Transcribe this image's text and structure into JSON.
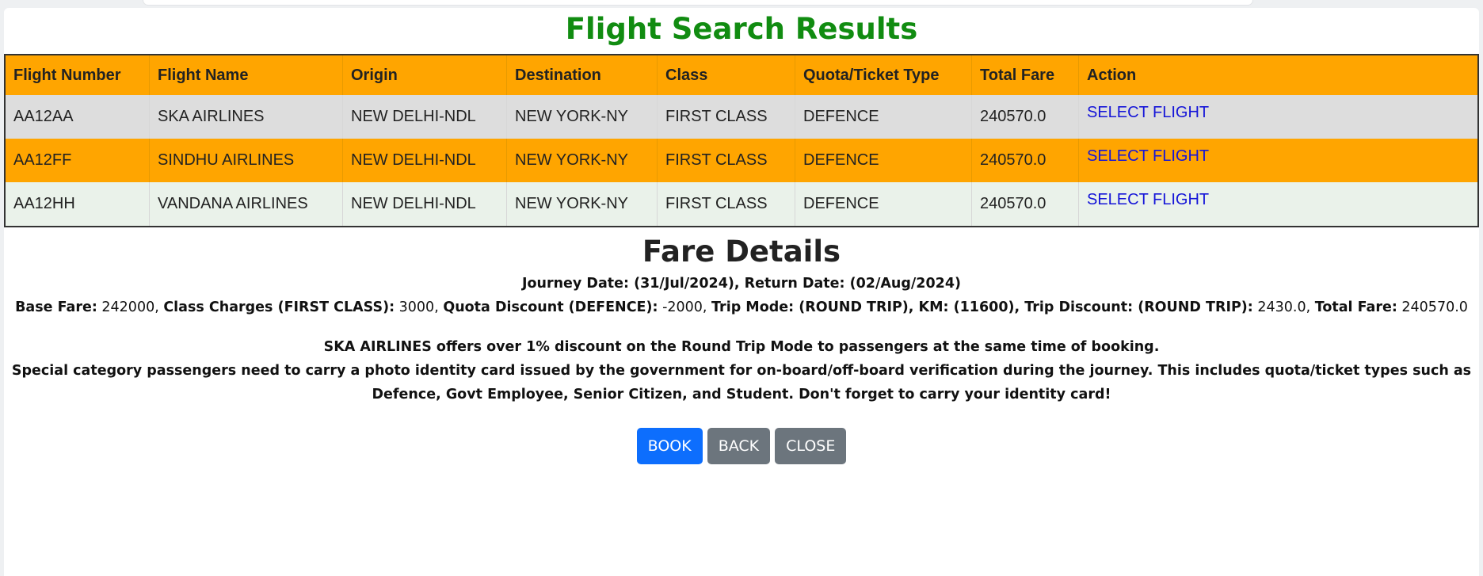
{
  "results": {
    "title": "Flight Search Results",
    "columns": [
      "Flight Number",
      "Flight Name",
      "Origin",
      "Destination",
      "Class",
      "Quota/Ticket Type",
      "Total Fare",
      "Action"
    ],
    "rows": [
      {
        "flight_number": "AA12AA",
        "flight_name": "SKA AIRLINES",
        "origin": "NEW DELHI-NDL",
        "destination": "NEW YORK-NY",
        "class": "FIRST CLASS",
        "quota": "DEFENCE",
        "total_fare": "240570.0",
        "action": "SELECT FLIGHT"
      },
      {
        "flight_number": "AA12FF",
        "flight_name": "SINDHU AIRLINES",
        "origin": "NEW DELHI-NDL",
        "destination": "NEW YORK-NY",
        "class": "FIRST CLASS",
        "quota": "DEFENCE",
        "total_fare": "240570.0",
        "action": "SELECT FLIGHT"
      },
      {
        "flight_number": "AA12HH",
        "flight_name": "VANDANA AIRLINES",
        "origin": "NEW DELHI-NDL",
        "destination": "NEW YORK-NY",
        "class": "FIRST CLASS",
        "quota": "DEFENCE",
        "total_fare": "240570.0",
        "action": "SELECT FLIGHT"
      }
    ]
  },
  "fare": {
    "title": "Fare Details",
    "dates_line": "Journey Date: (31/Jul/2024), Return Date: (02/Aug/2024)",
    "base_fare_label": "Base Fare:",
    "base_fare_value": " 242000, ",
    "class_charges_label": "Class Charges (FIRST CLASS):",
    "class_charges_value": " 3000, ",
    "quota_discount_label": "Quota Discount (DEFENCE):",
    "quota_discount_value": " -2000, ",
    "trip_mode_label": "Trip Mode: (ROUND TRIP), KM: (11600), Trip Discount: (ROUND TRIP):",
    "trip_discount_value": " 2430.0, ",
    "total_fare_label": "Total Fare:",
    "total_fare_value": " 240570.0",
    "discount_note": "SKA AIRLINES offers over 1% discount on the Round Trip Mode to passengers at the same time of booking.",
    "id_note": "Special category passengers need to carry a photo identity card issued by the government for on-board/off-board verification during the journey. This includes quota/ticket types such as Defence, Govt Employee, Senior Citizen, and Student. Don't forget to carry your identity card!"
  },
  "buttons": {
    "book": "BOOK",
    "back": "BACK",
    "close": "CLOSE"
  },
  "colors": {
    "title_green": "#118c11",
    "header_orange": "#ffa500",
    "link_blue": "#1515d8",
    "primary": "#0d6efd",
    "secondary": "#6c757d"
  }
}
